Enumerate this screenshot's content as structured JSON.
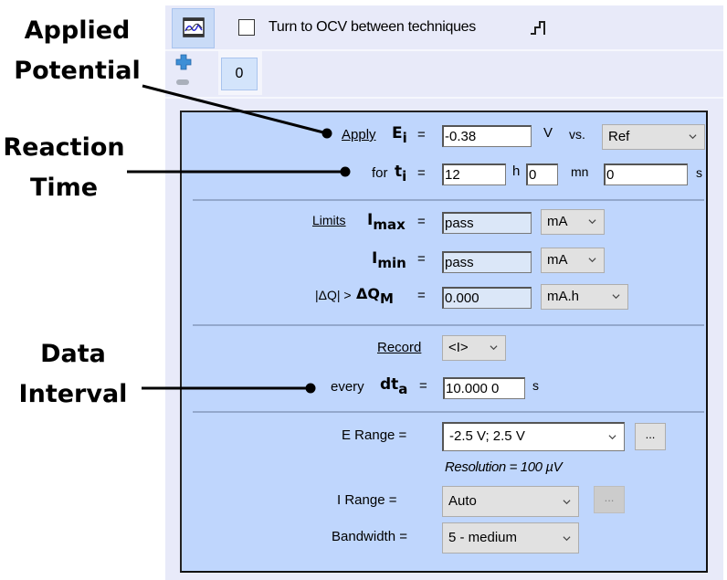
{
  "callouts": {
    "applied_potential": [
      "Applied",
      "Potential"
    ],
    "reaction_time": [
      "Reaction",
      "Time"
    ],
    "data_interval": [
      "Data",
      "Interval"
    ]
  },
  "toolbar": {
    "graph_icon": "technique-graph-icon",
    "ocv_checkbox_checked": false,
    "ocv_label": "Turn to OCV between techniques",
    "step_icon": "step-waveform-icon"
  },
  "sequence": {
    "add_icon": "plus-icon",
    "remove_icon": "minus-icon",
    "tabs": [
      "0"
    ]
  },
  "panel": {
    "apply": {
      "link": "Apply",
      "symbol": "E",
      "subscript": "i",
      "eq": "=",
      "value": "-0.38",
      "unit": "V",
      "vs_label": "vs.",
      "reference": "Ref"
    },
    "duration": {
      "label": "for",
      "symbol": "t",
      "subscript": "i",
      "eq": "=",
      "hours": "12",
      "hours_unit": "h",
      "minutes": "0",
      "minutes_unit": "mn",
      "seconds": "0",
      "seconds_unit": "s"
    },
    "limits": {
      "link": "Limits",
      "imax": {
        "symbol": "I",
        "subscript": "max",
        "eq": "=",
        "value": "pass",
        "unit": "mA"
      },
      "imin": {
        "symbol": "I",
        "subscript": "min",
        "eq": "=",
        "value": "pass",
        "unit": "mA"
      },
      "dq": {
        "prefix": "|ΔQ| >",
        "symbol": "ΔQ",
        "subscript": "M",
        "eq": "=",
        "value": "0.000",
        "unit": "mA.h"
      }
    },
    "record": {
      "link": "Record",
      "value": "<I>",
      "every_label": "every",
      "symbol": "dt",
      "subscript": "a",
      "eq": "=",
      "interval": "10.000 0",
      "interval_unit": "s"
    },
    "ranges": {
      "e_range_label": "E Range =",
      "e_range_value": "-2.5 V; 2.5 V",
      "e_range_more": "...",
      "resolution": "Resolution = 100 µV",
      "i_range_label": "I Range =",
      "i_range_value": "Auto",
      "i_range_more": "...",
      "bandwidth_label": "Bandwidth =",
      "bandwidth_value": "5 - medium"
    }
  }
}
